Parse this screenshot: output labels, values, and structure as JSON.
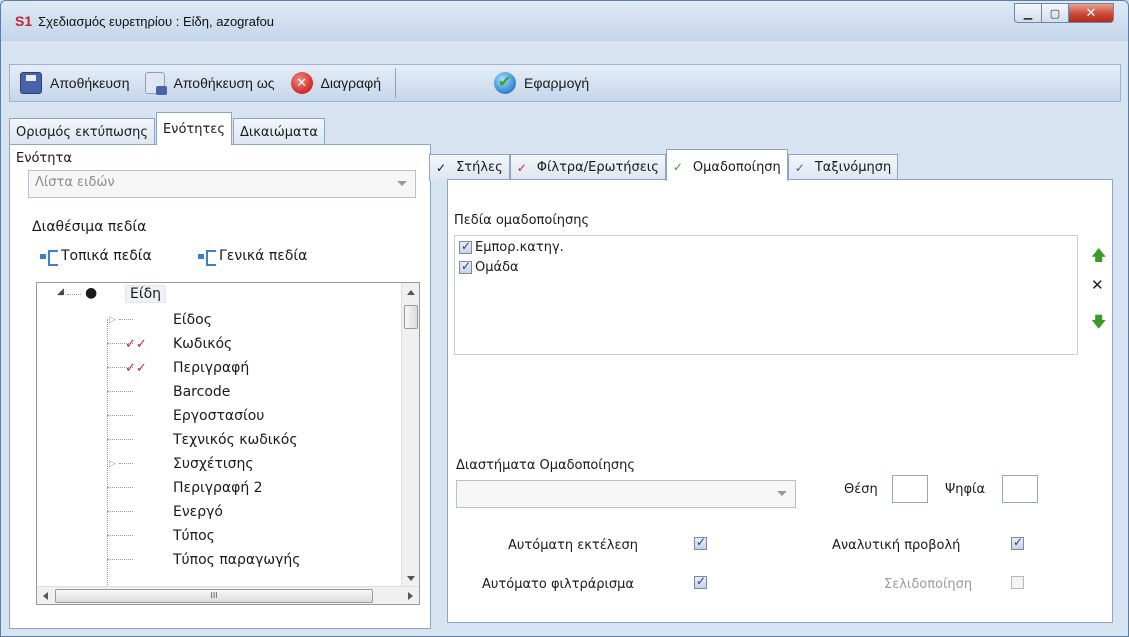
{
  "window": {
    "logo": "S1",
    "title": "Σχεδιασμός ευρετηρίου : Είδη, azografou"
  },
  "toolbar": {
    "save": "Αποθήκευση",
    "save_as": "Αποθήκευση ως",
    "delete": "Διαγραφή",
    "apply": "Εφαρμογή"
  },
  "main_tabs": [
    "Ορισμός εκτύπωσης",
    "Ενότητες",
    "Δικαιώματα"
  ],
  "left": {
    "section_label": "Ενότητα",
    "section_value": "Λίστα ειδών",
    "available_fields_label": "Διαθέσιμα πεδία",
    "local_fields": "Τοπικά πεδία",
    "general_fields": "Γενικά πεδία",
    "tree_root": "Είδη",
    "tree_items": [
      "Είδος",
      "Κωδικός",
      "Περιγραφή",
      "Barcode",
      "Εργοστασίου",
      "Τεχνικός κωδικός",
      "Συσχέτισης",
      "Περιγραφή 2",
      "Ενεργό",
      "Τύπος",
      "Τύπος παραγωγής"
    ],
    "hscroll_grip": "III"
  },
  "sub_tabs": [
    "Στήλες",
    "Φίλτρα/Ερωτήσεις",
    "Ομαδοποίηση",
    "Ταξινόμηση"
  ],
  "grouping": {
    "fields_label": "Πεδία ομαδοποίησης",
    "fields": [
      "Εμπορ.κατηγ.",
      "Ομάδα"
    ],
    "intervals_label": "Διαστήματα Ομαδοποίησης",
    "position_label": "Θέση",
    "digits_label": "Ψηφία",
    "auto_exec": "Αυτόματη εκτέλεση",
    "auto_filter": "Αυτόματο φιλτράρισμα",
    "detailed_view": "Αναλυτική προβολή",
    "pagination": "Σελιδοποίηση"
  },
  "colors": {
    "accent": "#1f5faa",
    "logo_red": "#c0262d",
    "window_bg": "#d7e3f1",
    "close_red": "#c9493a"
  }
}
